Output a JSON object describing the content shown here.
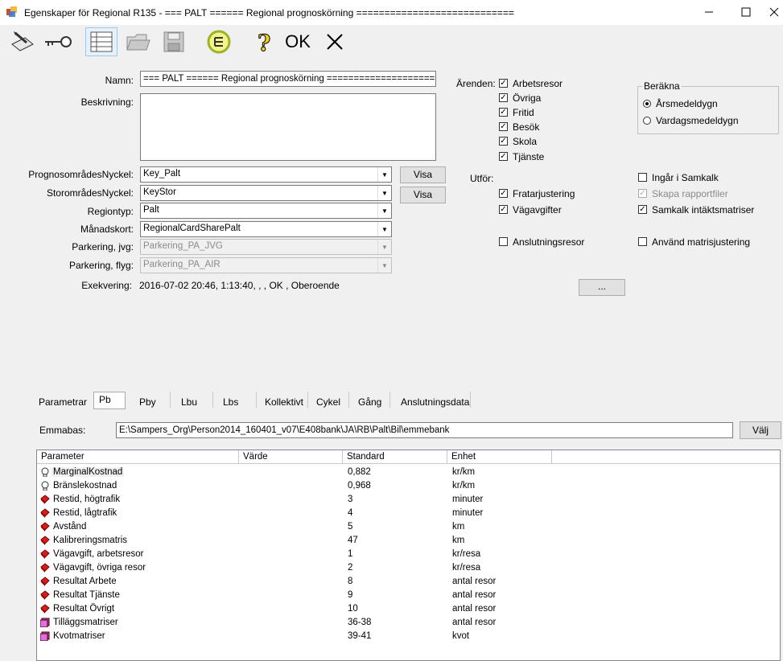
{
  "window": {
    "title": "Egenskaper för Regional R135 - === PALT ======  Regional prognoskörning ============================"
  },
  "toolbar": {
    "ok_label": "OK"
  },
  "form": {
    "name_label": "Namn:",
    "name_value": "=== PALT ======  Regional prognoskörning ===========================",
    "desc_label": "Beskrivning:",
    "desc_value": "",
    "prog_label": "PrognosområdesNyckel:",
    "prog_value": "Key_Palt",
    "stor_label": "StorområdesNyckel:",
    "stor_value": "KeyStor",
    "region_label": "Regiontyp:",
    "region_value": "Palt",
    "manad_label": "Månadskort:",
    "manad_value": "RegionalCardSharePalt",
    "pjvg_label": "Parkering, jvg:",
    "pjvg_value": "Parkering_PA_JVG",
    "pflyg_label": "Parkering, flyg:",
    "pflyg_value": "Parkering_PA_AIR",
    "exe_label": "Exekvering:",
    "exe_value": "2016-07-02 20:46, 1:13:40, , , OK   , Oberoende",
    "visa1": "Visa",
    "visa2": "Visa",
    "ellipsis": "..."
  },
  "arenden": {
    "label": "Ärenden:",
    "items": [
      {
        "label": "Arbetsresor",
        "checked": true
      },
      {
        "label": "Övriga",
        "checked": true
      },
      {
        "label": "Fritid",
        "checked": true
      },
      {
        "label": "Besök",
        "checked": true
      },
      {
        "label": "Skola",
        "checked": true
      },
      {
        "label": "Tjänste",
        "checked": true
      }
    ]
  },
  "berakna": {
    "label": "Beräkna",
    "options": [
      {
        "label": "Årsmedeldygn",
        "selected": true
      },
      {
        "label": "Vardagsmedeldygn",
        "selected": false
      }
    ]
  },
  "utfor": {
    "label": "Utför:",
    "fratar": {
      "label": "Fratarjustering",
      "checked": true
    },
    "vagavg": {
      "label": "Vägavgifter",
      "checked": true
    },
    "anslut": {
      "label": "Anslutningsresor",
      "checked": false
    },
    "samkalk": {
      "label": "Ingår i Samkalk",
      "checked": false
    },
    "rapport": {
      "label": "Skapa rapportfiler",
      "checked": true,
      "disabled": true
    },
    "intakt": {
      "label": "Samkalk intäktsmatriser",
      "checked": true
    },
    "matris": {
      "label": "Använd matrisjustering",
      "checked": false
    }
  },
  "tabs": [
    "Parametrar",
    "Pb",
    "Pby",
    "Lbu",
    "Lbs",
    "Kollektivt",
    "Cykel",
    "Gång",
    "Anslutningsdata"
  ],
  "emmabas": {
    "label": "Emmabas:",
    "path": "E:\\Sampers_Org\\Person2014_160401_v07\\E408bank\\JA\\RB\\Palt\\Bil\\emmebank",
    "button": "Välj"
  },
  "grid": {
    "headers": [
      "Parameter",
      "Värde",
      "Standard",
      "Enhet"
    ],
    "rows": [
      {
        "icon": "bulb-icon",
        "param": "MarginalKostnad",
        "value": "",
        "std": "0,882",
        "unit": "kr/km"
      },
      {
        "icon": "bulb-icon",
        "param": "Bränslekostnad",
        "value": "",
        "std": "0,968",
        "unit": "kr/km"
      },
      {
        "icon": "red-diamond-icon",
        "param": "Restid, högtrafik",
        "value": "",
        "std": "3",
        "unit": "minuter"
      },
      {
        "icon": "red-diamond-icon",
        "param": "Restid, lågtrafik",
        "value": "",
        "std": "4",
        "unit": "minuter"
      },
      {
        "icon": "red-diamond-icon",
        "param": "Avstånd",
        "value": "",
        "std": "5",
        "unit": "km"
      },
      {
        "icon": "red-diamond-icon",
        "param": "Kalibreringsmatris",
        "value": "",
        "std": "47",
        "unit": "km"
      },
      {
        "icon": "red-diamond-icon",
        "param": "Vägavgift, arbetsresor",
        "value": "",
        "std": "1",
        "unit": "kr/resa"
      },
      {
        "icon": "red-diamond-icon",
        "param": "Vägavgift, övriga resor",
        "value": "",
        "std": "2",
        "unit": "kr/resa"
      },
      {
        "icon": "red-diamond-icon",
        "param": "Resultat Arbete",
        "value": "",
        "std": "8",
        "unit": "antal resor"
      },
      {
        "icon": "red-diamond-icon",
        "param": "Resultat Tjänste",
        "value": "",
        "std": "9",
        "unit": "antal resor"
      },
      {
        "icon": "red-diamond-icon",
        "param": "Resultat Övrigt",
        "value": "",
        "std": "10",
        "unit": "antal resor"
      },
      {
        "icon": "stack-icon",
        "param": "Tilläggsmatriser",
        "value": "",
        "std": "36-38",
        "unit": "antal resor"
      },
      {
        "icon": "stack-icon",
        "param": "Kvotmatriser",
        "value": "",
        "std": "39-41",
        "unit": "kvot"
      }
    ]
  }
}
